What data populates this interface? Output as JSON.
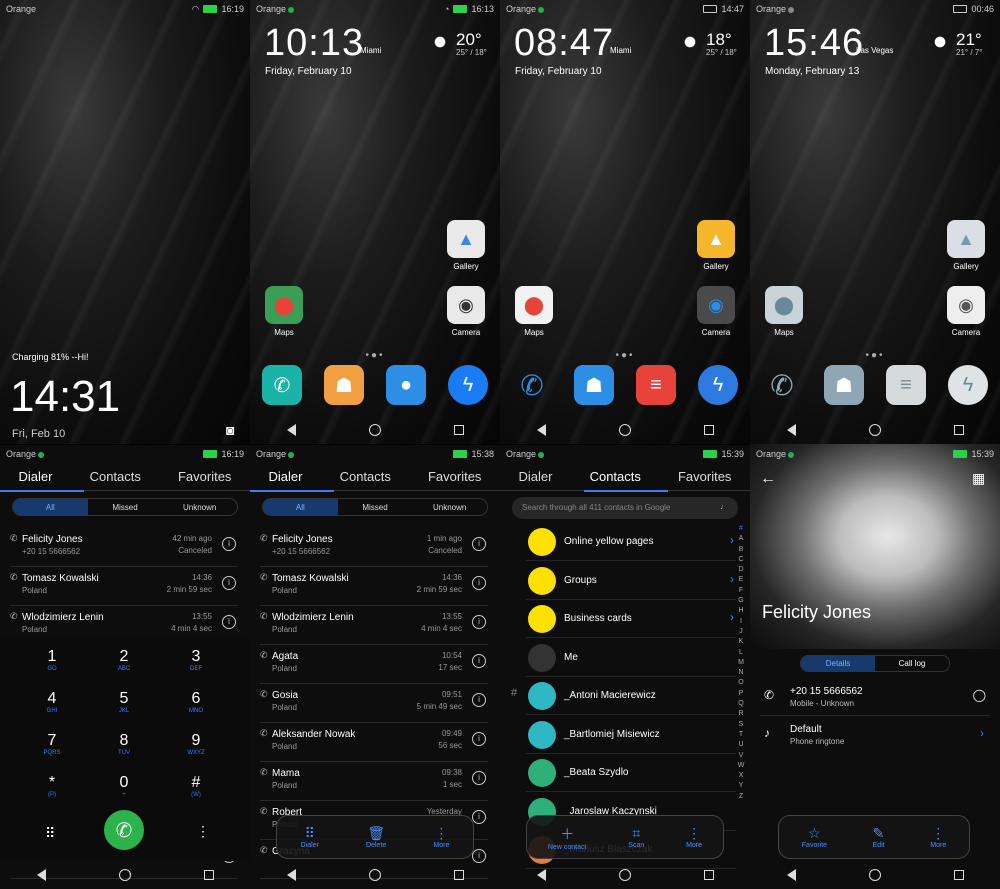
{
  "carrier": "Orange",
  "p1": {
    "time": "16:19",
    "charging": "Charging 81% --Hi!",
    "clock": "14:31",
    "date": "Fri, Feb 10"
  },
  "p2": {
    "time": "16:13",
    "clock": "10:13",
    "city": "Miami",
    "date": "Friday, February 10",
    "temp": "20°",
    "range": "25° / 18°",
    "apps": [
      "Gallery",
      "Maps",
      "Camera"
    ]
  },
  "p3": {
    "time": "14:47",
    "clock": "08:47",
    "city": "Miami",
    "date": "Friday, February 10",
    "temp": "18°",
    "range": "25° / 18°",
    "apps": [
      "Gallery",
      "Maps",
      "Camera"
    ]
  },
  "p4": {
    "time": "00:46",
    "clock": "15:46",
    "city": "Las Vegas",
    "date": "Monday, February 13",
    "temp": "21°",
    "range": "21° / 7°",
    "apps": [
      "Gallery",
      "Maps",
      "Camera"
    ]
  },
  "tabs": [
    "Dialer",
    "Contacts",
    "Favorites"
  ],
  "filters": [
    "All",
    "Missed",
    "Unknown"
  ],
  "p5": {
    "time": "16:19"
  },
  "p6": {
    "time": "15:38"
  },
  "p7": {
    "time": "15:39"
  },
  "p8": {
    "time": "15:39"
  },
  "calls": [
    {
      "name": "Felicity Jones",
      "place": "+20 15 5666562",
      "time": "42 min ago",
      "status": "Canceled",
      "time2": "1 min ago"
    },
    {
      "name": "Tomasz Kowalski",
      "place": "Poland",
      "time": "14:36",
      "status": "2 min 59 sec"
    },
    {
      "name": "Wlodzimierz Lenin",
      "place": "Poland",
      "time": "13:55",
      "status": "4 min 4 sec"
    },
    {
      "name": "Agata",
      "place": "Poland",
      "time": "10:54",
      "status": "17 sec"
    },
    {
      "name": "Gosia",
      "place": "Poland",
      "time": "09:51",
      "status": "5 min 49 sec"
    },
    {
      "name": "Aleksander Nowak",
      "place": "Poland",
      "time": "09:49",
      "status": "56 sec"
    },
    {
      "name": "Mama",
      "place": "Poland",
      "time": "09:38",
      "status": "1 sec"
    },
    {
      "name": "Robert",
      "place": "Poland",
      "time": "Yesterday",
      "status": ""
    },
    {
      "name": "Grazyna",
      "place": "",
      "time": "",
      "status": ""
    }
  ],
  "keys": [
    [
      "1",
      "GO"
    ],
    [
      "2",
      "ABC"
    ],
    [
      "3",
      "DEF"
    ],
    [
      "4",
      "GHI"
    ],
    [
      "5",
      "JKL"
    ],
    [
      "6",
      "MNO"
    ],
    [
      "7",
      "PQRS"
    ],
    [
      "8",
      "TUV"
    ],
    [
      "9",
      "WXYZ"
    ],
    [
      "*",
      "(P)"
    ],
    [
      "0",
      "+"
    ],
    [
      "#",
      "(W)"
    ]
  ],
  "dialer_pill": [
    "Dialer",
    "Delete",
    "More"
  ],
  "contacts": {
    "search": "Search through all 411 contacts in Google",
    "rows": [
      "Online yellow pages",
      "Groups",
      "Business cards",
      "Me",
      "_Antoni Macierewicz",
      "_Bartlomiej Misiewicz",
      "_Beata Szydlo",
      "_Jaroslaw Kaczynski",
      "_Mariusz Blaszczak"
    ],
    "section": "#",
    "alpha": [
      "#",
      "A",
      "B",
      "C",
      "D",
      "E",
      "F",
      "G",
      "H",
      "I",
      "J",
      "K",
      "L",
      "M",
      "N",
      "O",
      "P",
      "Q",
      "R",
      "S",
      "T",
      "U",
      "V",
      "W",
      "X",
      "Y",
      "Z"
    ],
    "pill": [
      "New contact",
      "Scan",
      "More"
    ]
  },
  "profile": {
    "name": "Felicity Jones",
    "tabs": [
      "Details",
      "Call log"
    ],
    "phone": "+20 15 5666562",
    "phone_sub": "Mobile - Unknown",
    "ring": "Default",
    "ring_sub": "Phone ringtone",
    "pill": [
      "Favorite",
      "Edit",
      "More"
    ]
  }
}
